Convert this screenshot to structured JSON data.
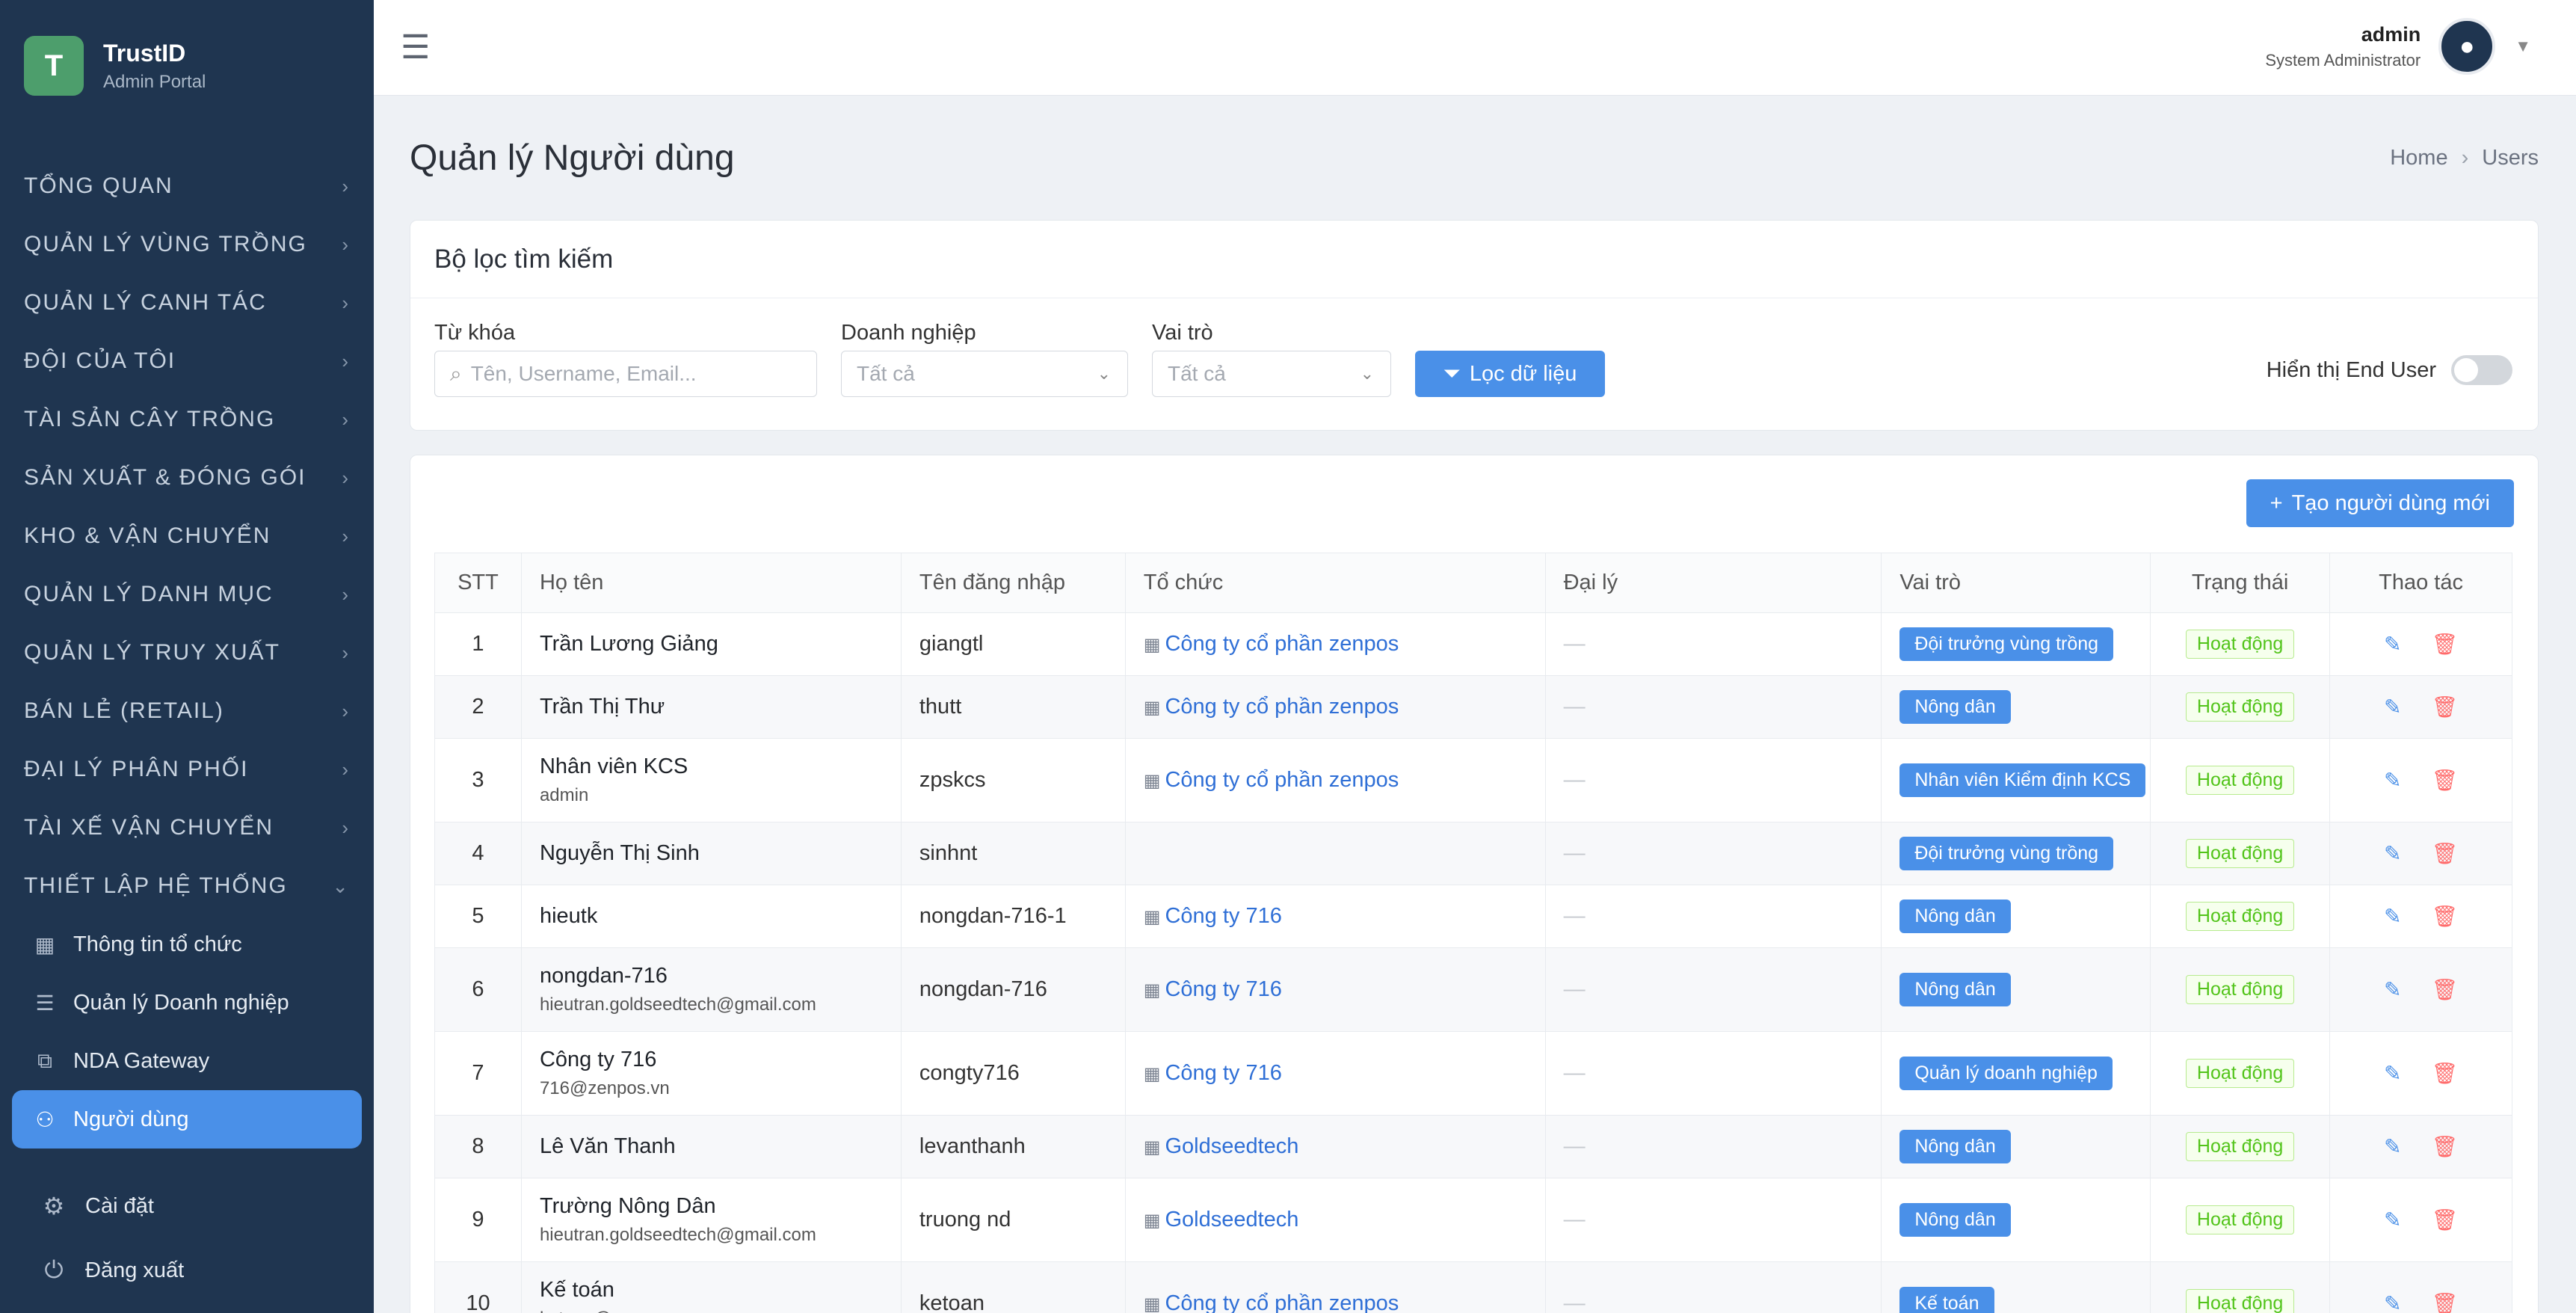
{
  "brand": {
    "initial": "T",
    "name": "TrustID",
    "subtitle": "Admin Portal"
  },
  "sidebar": {
    "groups": [
      {
        "label": "TỔNG QUAN"
      },
      {
        "label": "QUẢN LÝ VÙNG TRỒNG"
      },
      {
        "label": "QUẢN LÝ CANH TÁC"
      },
      {
        "label": "ĐỘI CỦA TÔI"
      },
      {
        "label": "TÀI SẢN CÂY TRỒNG"
      },
      {
        "label": "SẢN XUẤT & ĐÓNG GÓI"
      },
      {
        "label": "KHO & VẬN CHUYỂN"
      },
      {
        "label": "QUẢN LÝ DANH MỤC"
      },
      {
        "label": "QUẢN LÝ TRUY XUẤT"
      },
      {
        "label": "BÁN LẺ (RETAIL)"
      },
      {
        "label": "ĐẠI LÝ PHÂN PHỐI"
      },
      {
        "label": "TÀI XẾ VẬN CHUYỂN"
      },
      {
        "label": "THIẾT LẬP HỆ THỐNG"
      }
    ],
    "sub_items": [
      {
        "label": "Thông tin tổ chức",
        "icon": "building-icon"
      },
      {
        "label": "Quản lý Doanh nghiệp",
        "icon": "sliders-icon"
      },
      {
        "label": "NDA Gateway",
        "icon": "gateway-icon"
      },
      {
        "label": "Người dùng",
        "icon": "user-icon",
        "active": true
      }
    ],
    "bottom": [
      {
        "label": "Cài đặt",
        "icon": "gear-icon"
      },
      {
        "label": "Đăng xuất",
        "icon": "power-icon"
      }
    ]
  },
  "header": {
    "user_name": "admin",
    "user_role": "System Administrator"
  },
  "page": {
    "title": "Quản lý Người dùng",
    "breadcrumb": [
      "Home",
      "Users"
    ]
  },
  "filter": {
    "title": "Bộ lọc tìm kiếm",
    "keyword_label": "Từ khóa",
    "keyword_placeholder": "Tên, Username, Email...",
    "company_label": "Doanh nghiệp",
    "company_value": "Tất cả",
    "role_label": "Vai trò",
    "role_value": "Tất cả",
    "filter_button": "Lọc dữ liệu",
    "end_user_label": "Hiển thị End User"
  },
  "table": {
    "create_button": "Tạo người dùng mới",
    "columns": [
      "STT",
      "Họ tên",
      "Tên đăng nhập",
      "Tổ chức",
      "Đại lý",
      "Vai trò",
      "Trạng thái",
      "Thao tác"
    ],
    "rows": [
      {
        "stt": "1",
        "name": "Trần Lương Giảng",
        "email": "",
        "username": "giangtl",
        "org": "Công ty cổ phần zenpos",
        "agent": "—",
        "role": "Đội trưởng vùng trồng",
        "status": "Hoạt động"
      },
      {
        "stt": "2",
        "name": "Trần Thị Thư",
        "email": "",
        "username": "thutt",
        "org": "Công ty cổ phần zenpos",
        "agent": "—",
        "role": "Nông dân",
        "status": "Hoạt động"
      },
      {
        "stt": "3",
        "name": "Nhân viên KCS",
        "email": "admin",
        "username": "zpskcs",
        "org": "Công ty cổ phần zenpos",
        "agent": "—",
        "role": "Nhân viên Kiểm định KCS",
        "status": "Hoạt động"
      },
      {
        "stt": "4",
        "name": "Nguyễn Thị Sinh",
        "email": "",
        "username": "sinhnt",
        "org": "",
        "agent": "—",
        "role": "Đội trưởng vùng trồng",
        "status": "Hoạt động"
      },
      {
        "stt": "5",
        "name": "hieutk",
        "email": "",
        "username": "nongdan-716-1",
        "org": "Công ty 716",
        "agent": "—",
        "role": "Nông dân",
        "status": "Hoạt động"
      },
      {
        "stt": "6",
        "name": "nongdan-716",
        "email": "hieutran.goldseedtech@gmail.com",
        "username": "nongdan-716",
        "org": "Công ty 716",
        "agent": "—",
        "role": "Nông dân",
        "status": "Hoạt động"
      },
      {
        "stt": "7",
        "name": "Công ty 716",
        "email": "716@zenpos.vn",
        "username": "congty716",
        "org": "Công ty 716",
        "agent": "—",
        "role": "Quản lý doanh nghiệp",
        "status": "Hoạt động"
      },
      {
        "stt": "8",
        "name": "Lê Văn Thanh",
        "email": "",
        "username": "levanthanh",
        "org": "Goldseedtech",
        "agent": "—",
        "role": "Nông dân",
        "status": "Hoạt động"
      },
      {
        "stt": "9",
        "name": "Trường Nông Dân",
        "email": "hieutran.goldseedtech@gmail.com",
        "username": "truong nd",
        "org": "Goldseedtech",
        "agent": "—",
        "role": "Nông dân",
        "status": "Hoạt động"
      },
      {
        "stt": "10",
        "name": "Kế toán",
        "email": "ketoan@zenpos.vn",
        "username": "ketoan",
        "org": "Công ty cổ phần zenpos",
        "agent": "—",
        "role": "Kế toán",
        "status": "Hoạt động"
      }
    ]
  }
}
